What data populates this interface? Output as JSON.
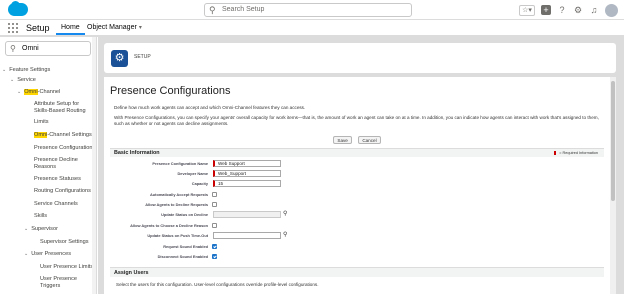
{
  "topbar": {
    "search_placeholder": "Search Setup",
    "favorites_icon": "star-dropdown-icon",
    "icons": [
      "plus-icon",
      "help-icon",
      "gear-icon",
      "bell-icon",
      "avatar"
    ]
  },
  "nav": {
    "app_name": "Setup",
    "tabs": [
      {
        "label": "Home"
      },
      {
        "label": "Object Manager"
      }
    ]
  },
  "sidebar": {
    "quick_find_value": "Omni",
    "tree": [
      {
        "label": "Feature Settings",
        "level": 0,
        "expanded": true
      },
      {
        "label": "Service",
        "level": 1,
        "expanded": true
      },
      {
        "label_highlight": "Omni",
        "label_rest": "-Channel",
        "level": 2,
        "expanded": true
      },
      {
        "label": "Attribute Setup for Skills-Based Routing",
        "level": 3
      },
      {
        "label": "Limits",
        "level": 3
      },
      {
        "label_highlight": "Omni",
        "label_rest": "-Channel Settings",
        "level": 3
      },
      {
        "label": "Presence Configurations",
        "level": 3
      },
      {
        "label": "Presence Decline Reasons",
        "level": 3
      },
      {
        "label": "Presence Statuses",
        "level": 3
      },
      {
        "label": "Routing Configurations",
        "level": 3
      },
      {
        "label": "Service Channels",
        "level": 3
      },
      {
        "label": "Skills",
        "level": 3
      },
      {
        "label": "Supervisor",
        "level": 2,
        "expanded": true
      },
      {
        "label": "Supervisor Settings",
        "level": 3
      },
      {
        "label": "User Presences",
        "level": 2,
        "expanded": true
      },
      {
        "label": "User Presence Limits",
        "level": 3
      },
      {
        "label": "User Presence Triggers",
        "level": 3
      }
    ]
  },
  "main": {
    "setup_label": "SETUP",
    "title": "Presence Configurations",
    "description": "Define how much work agents can accept and which Omni-Channel features they can access.",
    "description2": "With Presence Configurations, you can specify your agents' overall capacity for work items—that is, the amount of work an agent can take on at a time. In addition, you can indicate how agents can interact with work that's assigned to them, such as whether or not agents can decline assignments.",
    "buttons": {
      "save": "Save",
      "cancel": "Cancel"
    },
    "basic_info_title": "Basic Information",
    "required_legend": "= Required Information",
    "fields": {
      "config_name": {
        "label": "Presence Configuration Name",
        "value": "Web Support"
      },
      "developer_name": {
        "label": "Developer Name",
        "value": "Web_Support"
      },
      "capacity": {
        "label": "Capacity",
        "value": "15"
      },
      "auto_accept": {
        "label": "Automatically Accept Requests",
        "checked": false
      },
      "allow_decline": {
        "label": "Allow Agents to Decline Requests",
        "checked": false
      },
      "update_on_decline": {
        "label": "Update Status on Decline",
        "value": ""
      },
      "choose_decline_reason": {
        "label": "Allow Agents to Choose a Decline Reason",
        "checked": false
      },
      "update_on_push_timeout": {
        "label": "Update Status on Push Time-Out",
        "value": ""
      },
      "request_sound": {
        "label": "Request Sound Enabled",
        "checked": true
      },
      "disconnect_sound": {
        "label": "Disconnect Sound Enabled",
        "checked": true
      }
    },
    "assign_users_title": "Assign Users",
    "assign_users_desc": "Select the users for this configuration. User-level configurations override profile-level configurations."
  }
}
